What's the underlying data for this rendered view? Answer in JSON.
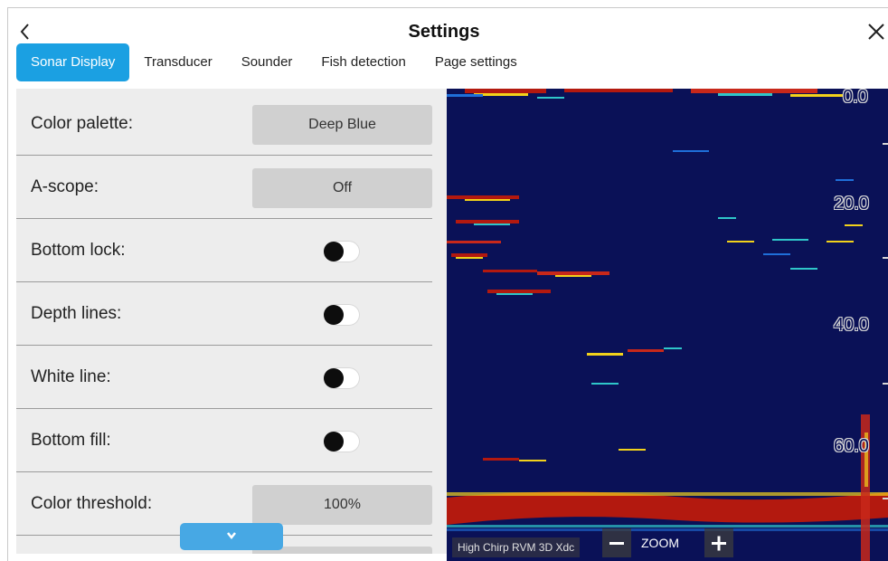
{
  "header": {
    "title": "Settings"
  },
  "tabs": [
    {
      "label": "Sonar Display",
      "active": true
    },
    {
      "label": "Transducer",
      "active": false
    },
    {
      "label": "Sounder",
      "active": false
    },
    {
      "label": "Fish detection",
      "active": false
    },
    {
      "label": "Page settings",
      "active": false
    }
  ],
  "settings": {
    "color_palette": {
      "label": "Color palette:",
      "value": "Deep Blue"
    },
    "a_scope": {
      "label": "A-scope:",
      "value": "Off"
    },
    "bottom_lock": {
      "label": "Bottom lock:",
      "on": false
    },
    "depth_lines": {
      "label": "Depth lines:",
      "on": false
    },
    "white_line": {
      "label": "White line:",
      "on": false
    },
    "bottom_fill": {
      "label": "Bottom fill:",
      "on": false
    },
    "color_threshold": {
      "label": "Color threshold:",
      "value": "100%"
    }
  },
  "sonar": {
    "depth_scale": [
      "0.0",
      "20.0",
      "40.0",
      "60.0"
    ],
    "source": "High Chirp RVM 3D Xdc",
    "zoom_label": "ZOOM",
    "background_color": "#0a1157",
    "bottom_color": "#b3190f"
  },
  "colors": {
    "accent": "#1ba0e2"
  },
  "icons": {
    "back": "chevron-left-icon",
    "close": "close-icon",
    "scroll": "chevron-down-icon",
    "zoom_out": "minus-icon",
    "zoom_in": "plus-icon"
  }
}
